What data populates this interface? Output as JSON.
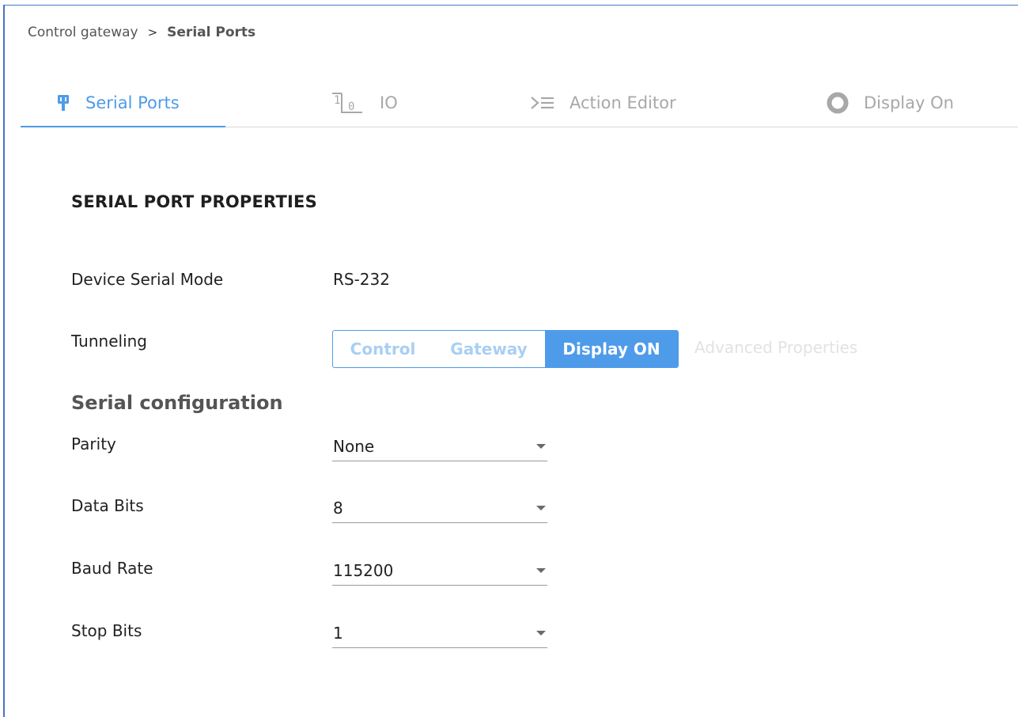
{
  "breadcrumb": {
    "parent": "Control gateway",
    "separator": ">",
    "current": "Serial Ports"
  },
  "tabs": [
    {
      "label": "Serial Ports",
      "icon": "plug-icon",
      "active": true
    },
    {
      "label": "IO",
      "icon": "io-icon",
      "active": false
    },
    {
      "label": "Action Editor",
      "icon": "action-list-icon",
      "active": false
    },
    {
      "label": "Display On",
      "icon": "ring-icon",
      "active": false
    }
  ],
  "section": {
    "title": "SERIAL PORT PROPERTIES"
  },
  "device_serial_mode": {
    "label": "Device Serial Mode",
    "value": "RS-232"
  },
  "tunneling": {
    "label": "Tunneling",
    "options": [
      "Control",
      "Gateway",
      "Display ON"
    ],
    "selected": "Display ON",
    "advanced_link": "Advanced Properties"
  },
  "serial_config": {
    "heading": "Serial configuration",
    "fields": [
      {
        "label": "Parity",
        "value": "None"
      },
      {
        "label": "Data Bits",
        "value": "8"
      },
      {
        "label": "Baud Rate",
        "value": "115200"
      },
      {
        "label": "Stop Bits",
        "value": "1"
      }
    ]
  },
  "colors": {
    "accent": "#4e9bea",
    "inactive_tab": "#a8a8a8",
    "frame_border": "#4a73c8"
  }
}
